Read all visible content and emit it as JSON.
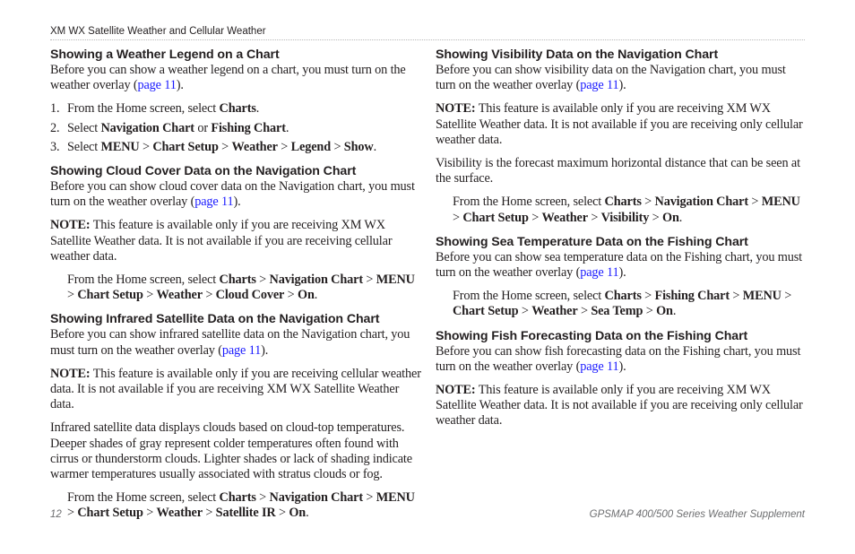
{
  "header": {
    "title": "XM WX Satellite Weather and Cellular Weather"
  },
  "colors": {
    "link": "#1a1aff",
    "text": "#231f20",
    "footer": "#6d6e70"
  },
  "left": {
    "s1": {
      "heading": "Showing a Weather Legend on a Chart",
      "intro_before": "Before you can show a weather legend on a chart, you must turn on the weather overlay (",
      "link": "page 11",
      "intro_after": ").",
      "steps": [
        {
          "num": "1.",
          "parts": [
            "From the Home screen, select ",
            "Charts",
            "."
          ]
        },
        {
          "num": "2.",
          "parts": [
            "Select ",
            "Navigation Chart",
            " or ",
            "Fishing Chart",
            "."
          ]
        },
        {
          "num": "3.",
          "parts": [
            "Select ",
            "MENU",
            " > ",
            "Chart Setup",
            " > ",
            "Weather",
            " > ",
            "Legend",
            " > ",
            "Show",
            "."
          ]
        }
      ]
    },
    "s2": {
      "heading": "Showing Cloud Cover Data on the Navigation Chart",
      "intro_before": "Before you can show cloud cover data on the Navigation chart, you must turn on the weather overlay (",
      "link": "page 11",
      "intro_after": ").",
      "note_label": "NOTE:",
      "note_text": " This feature is available only if you are receiving XM WX Satellite Weather data. It is not available if you are receiving cellular weather data.",
      "path_prefix": "From the Home screen, select ",
      "path": [
        "Charts",
        "Navigation Chart",
        "MENU",
        "Chart Setup",
        "Weather",
        "Cloud Cover",
        "On"
      ]
    },
    "s3": {
      "heading": "Showing Infrared Satellite Data on the Navigation Chart",
      "intro_before": "Before you can show infrared satellite data on the Navigation chart, you must turn on the weather overlay (",
      "link": "page 11",
      "intro_after": ").",
      "note_label": "NOTE:",
      "note_text": " This feature is available only if you are receiving cellular weather data. It is not available if you are receiving XM WX Satellite Weather data.",
      "body": "Infrared satellite data displays clouds based on cloud-top temperatures. Deeper shades of gray represent colder temperatures often found with cirrus or thunderstorm clouds. Lighter shades or lack of shading indicate warmer temperatures usually associated with stratus clouds or fog.",
      "path_prefix": "From the Home screen, select ",
      "path": [
        "Charts",
        "Navigation Chart",
        "MENU",
        "Chart Setup",
        "Weather",
        "Satellite IR",
        "On"
      ]
    }
  },
  "right": {
    "s4": {
      "heading": "Showing Visibility Data on the Navigation Chart",
      "intro_before": "Before you can show visibility data on the Navigation chart, you must turn on the weather overlay (",
      "link": "page 11",
      "intro_after": ").",
      "note_label": "NOTE:",
      "note_text": " This feature is available only if you are receiving XM WX Satellite Weather data. It is not available if you are receiving only cellular weather data.",
      "body": "Visibility is the forecast maximum horizontal distance that can be seen at the surface.",
      "path_prefix": "From the Home screen, select ",
      "path": [
        "Charts",
        "Navigation Chart",
        "MENU",
        "Chart Setup",
        "Weather",
        "Visibility",
        "On"
      ]
    },
    "s5": {
      "heading": "Showing Sea Temperature Data on the Fishing Chart",
      "intro_before": "Before you can show sea temperature data on the Fishing chart, you must turn on the weather overlay (",
      "link": "page 11",
      "intro_after": ").",
      "path_prefix": "From the Home screen, select ",
      "path": [
        "Charts",
        "Fishing Chart",
        "MENU",
        "Chart Setup",
        "Weather",
        "Sea Temp",
        "On"
      ]
    },
    "s6": {
      "heading": "Showing Fish Forecasting Data on the Fishing Chart",
      "intro_before": "Before you can show fish forecasting data on the Fishing chart, you must turn on the weather overlay (",
      "link": "page 11",
      "intro_after": ").",
      "note_label": "NOTE:",
      "note_text": " This feature is available only if you are receiving XM WX Satellite Weather data. It is not available if you are receiving only cellular weather data."
    }
  },
  "footer": {
    "page_number": "12",
    "doc_title": "GPSMAP 400/500 Series Weather Supplement"
  }
}
